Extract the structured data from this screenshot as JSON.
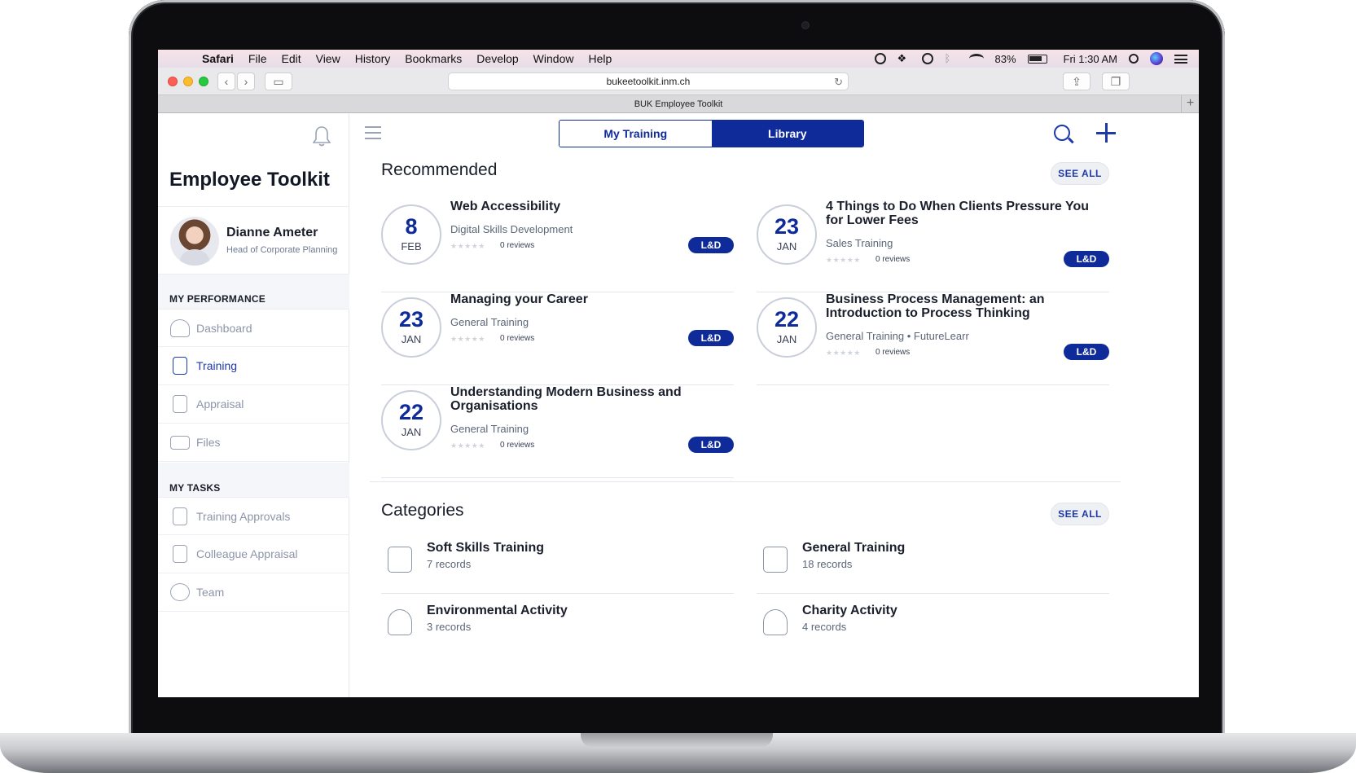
{
  "menubar": {
    "app": "Safari",
    "items": [
      "File",
      "Edit",
      "View",
      "History",
      "Bookmarks",
      "Develop",
      "Window",
      "Help"
    ],
    "battery": "83%",
    "clock": "Fri 1:30 AM"
  },
  "browser": {
    "url": "bukeetoolkit.inm.ch",
    "tab_title": "BUK Employee Toolkit"
  },
  "sidebar": {
    "app_title": "Employee Toolkit",
    "user": {
      "name": "Dianne Ameter",
      "role": "Head of Corporate Planning"
    },
    "performance_header": "MY PERFORMANCE",
    "performance_items": [
      {
        "label": "Dashboard",
        "icon": "dashboard-gauge-icon"
      },
      {
        "label": "Training",
        "icon": "book-icon",
        "active": true
      },
      {
        "label": "Appraisal",
        "icon": "clipboard-star-icon"
      },
      {
        "label": "Files",
        "icon": "folder-icon"
      }
    ],
    "tasks_header": "MY TASKS",
    "task_items": [
      {
        "label": "Training Approvals",
        "icon": "clipboard-check-icon"
      },
      {
        "label": "Colleague Appraisal",
        "icon": "clipboard-check-icon"
      },
      {
        "label": "Team",
        "icon": "team-icon"
      }
    ]
  },
  "main": {
    "tabs": [
      {
        "label": "My Training"
      },
      {
        "label": "Library",
        "selected": true
      }
    ],
    "recommended_title": "Recommended",
    "categories_title": "Categories",
    "see_all_label": "SEE ALL",
    "recommended": [
      {
        "day": "8",
        "month": "FEB",
        "title": "Web Accessibility",
        "subtitle": "Digital Skills Development",
        "stars": "★★★★★",
        "reviews": "0 reviews",
        "badge": "L&D"
      },
      {
        "day": "23",
        "month": "JAN",
        "title": "4 Things to Do When Clients Pressure You for Lower Fees",
        "subtitle": "Sales Training",
        "stars": "★★★★★",
        "reviews": "0 reviews",
        "badge": "L&D"
      },
      {
        "day": "23",
        "month": "JAN",
        "title": "Managing your Career",
        "subtitle": "General Training",
        "stars": "★★★★★",
        "reviews": "0 reviews",
        "badge": "L&D"
      },
      {
        "day": "22",
        "month": "JAN",
        "title": "Business Process Management: an Introduction to Process Thinking",
        "subtitle": "General Training • FutureLearr",
        "stars": "★★★★★",
        "reviews": "0 reviews",
        "badge": "L&D"
      },
      {
        "day": "22",
        "month": "JAN",
        "title": "Understanding Modern Business and Organisations",
        "subtitle": "General Training",
        "stars": "★★★★★",
        "reviews": "0 reviews",
        "badge": "L&D"
      }
    ],
    "categories": [
      {
        "name": "Soft Skills Training",
        "count": "7 records",
        "icon": "people-chat-icon"
      },
      {
        "name": "General Training",
        "count": "18 records",
        "icon": "notebook-icon"
      },
      {
        "name": "Environmental Activity",
        "count": "3 records",
        "icon": "plant-hand-icon"
      },
      {
        "name": "Charity Activity",
        "count": "4 records",
        "icon": "hand-heart-icon"
      }
    ]
  },
  "colors": {
    "accent": "#0f2b9a",
    "muted": "#8c95a8"
  }
}
